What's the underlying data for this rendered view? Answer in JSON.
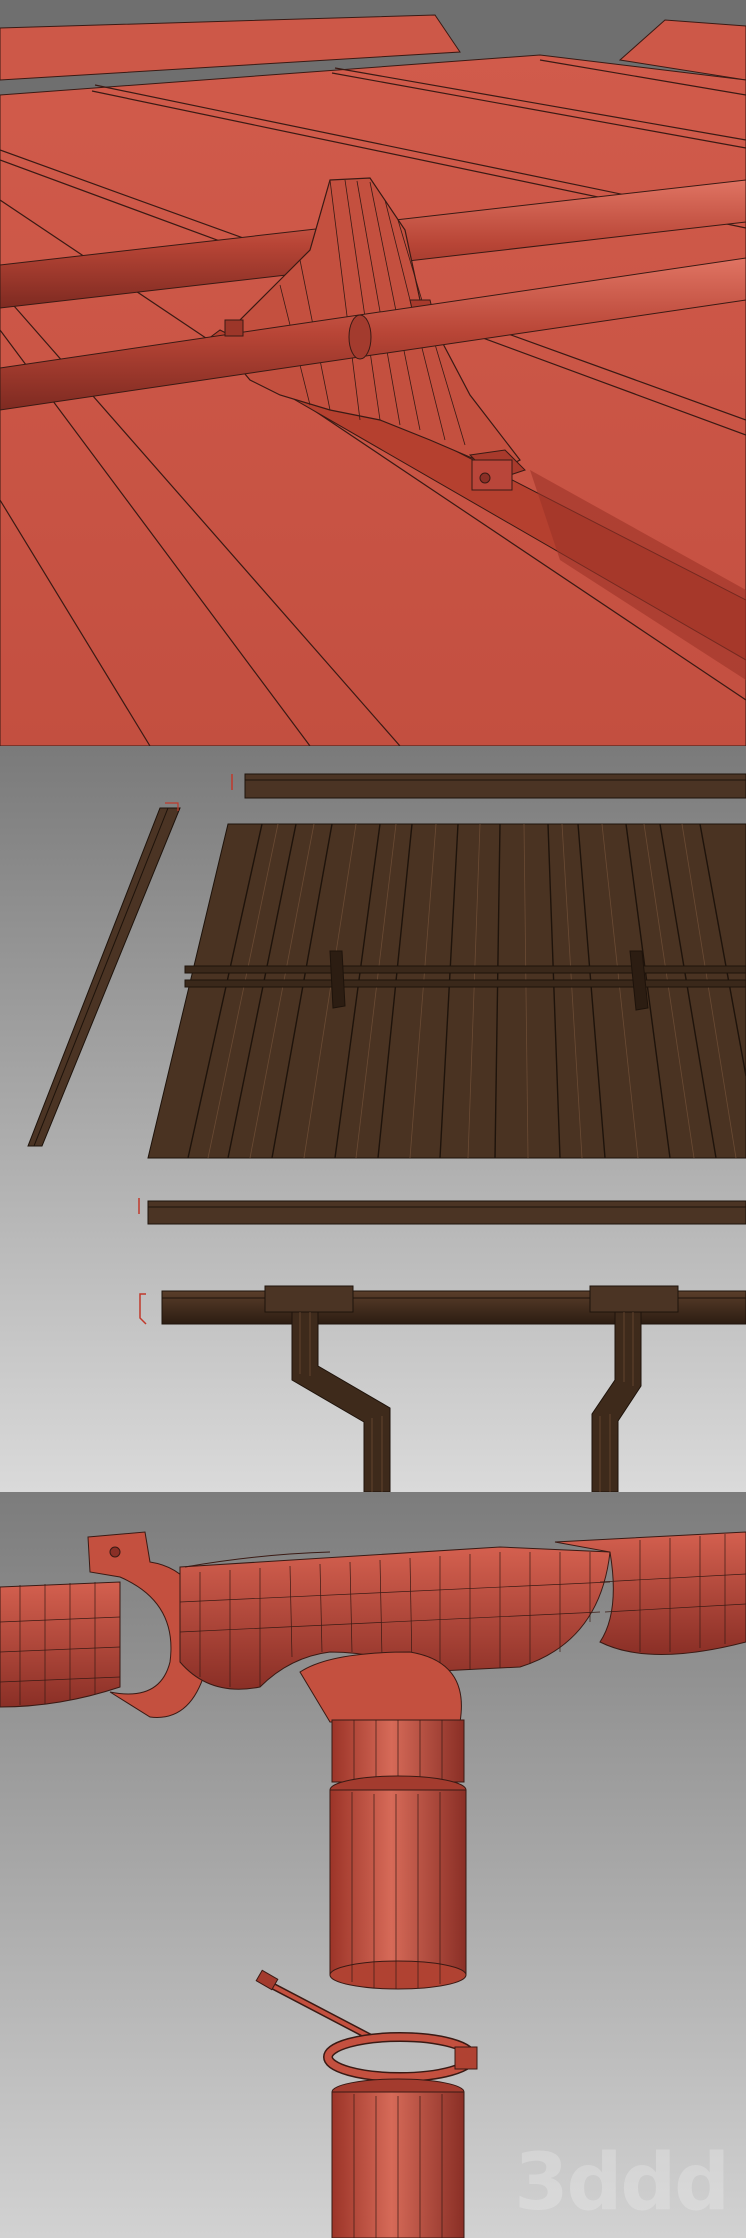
{
  "panels": [
    {
      "id": "roof-closeup",
      "theme": "red",
      "colors": {
        "sky": "#6f6f6f",
        "roof": "#cd5848",
        "roof_dark": "#a7382c",
        "line": "#3a1a14"
      }
    },
    {
      "id": "parts-overview",
      "theme": "brown",
      "colors": {
        "bg_top": "#7a7a7a",
        "bg_bottom": "#d9d9d9",
        "metal": "#4b3424",
        "metal_dark": "#2c1d12",
        "marker": "#c0392b"
      }
    },
    {
      "id": "gutter-closeup",
      "theme": "red",
      "colors": {
        "bg_top": "#7c7c7c",
        "bg_bottom": "#d0d0d0",
        "metal": "#c85243",
        "metal_dark": "#8a2f26",
        "line": "#3a1a14"
      }
    }
  ],
  "watermark": {
    "text": "3ddd"
  }
}
